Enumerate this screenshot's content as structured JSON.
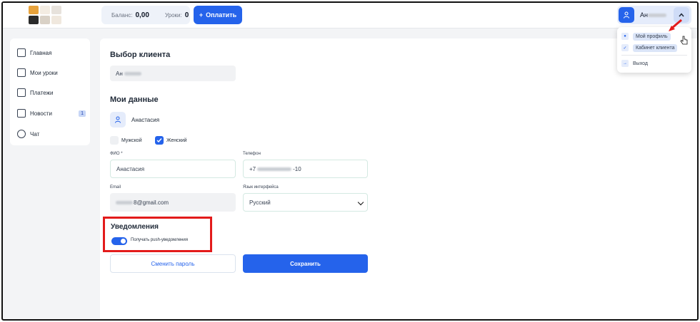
{
  "topbar": {
    "balance_label": "Баланс:",
    "balance_value": "0,00",
    "lessons_label": "Уроки:",
    "lessons_value": "0",
    "pay_button": "Оплатить",
    "pay_icon": "plus-icon",
    "user_name": "Ан",
    "user_icon": "user-icon",
    "chevron_icon": "chevron-up-icon"
  },
  "dropdown": {
    "items": [
      {
        "label": "Мой профиль",
        "icon": "user-icon"
      },
      {
        "label": "Кабинет клиента",
        "icon": "check-icon"
      },
      {
        "label": "Выход",
        "icon": "logout-icon"
      }
    ]
  },
  "sidebar": {
    "items": [
      {
        "label": "Главная",
        "icon": "home-icon"
      },
      {
        "label": "Мои уроки",
        "icon": "calendar-icon"
      },
      {
        "label": "Платежи",
        "icon": "card-icon"
      },
      {
        "label": "Новости",
        "icon": "news-icon",
        "badge": "1"
      },
      {
        "label": "Чат",
        "icon": "chat-icon"
      }
    ]
  },
  "main": {
    "client_section_title": "Выбор клиента",
    "client_value": "Ан",
    "my_data_title": "Мои данные",
    "profile_name": "Анастасия",
    "gender_male": "Мужской",
    "gender_female": "Женский",
    "fio_label": "ФИО *",
    "fio_value": "Анастасия",
    "phone_label": "Телефон",
    "phone_prefix": "+7",
    "phone_suffix": "-10",
    "email_label": "Email",
    "email_suffix": "8@gmail.com",
    "language_label": "Язык интерфейса",
    "language_value": "Русский",
    "notifications_title": "Уведомления",
    "push_label": "Получать push-уведомления",
    "change_password": "Сменить пароль",
    "save": "Сохранить"
  },
  "colors": {
    "accent": "#2563eb",
    "highlight_border": "#e31b1b",
    "page_bg": "#f3f4f6"
  }
}
